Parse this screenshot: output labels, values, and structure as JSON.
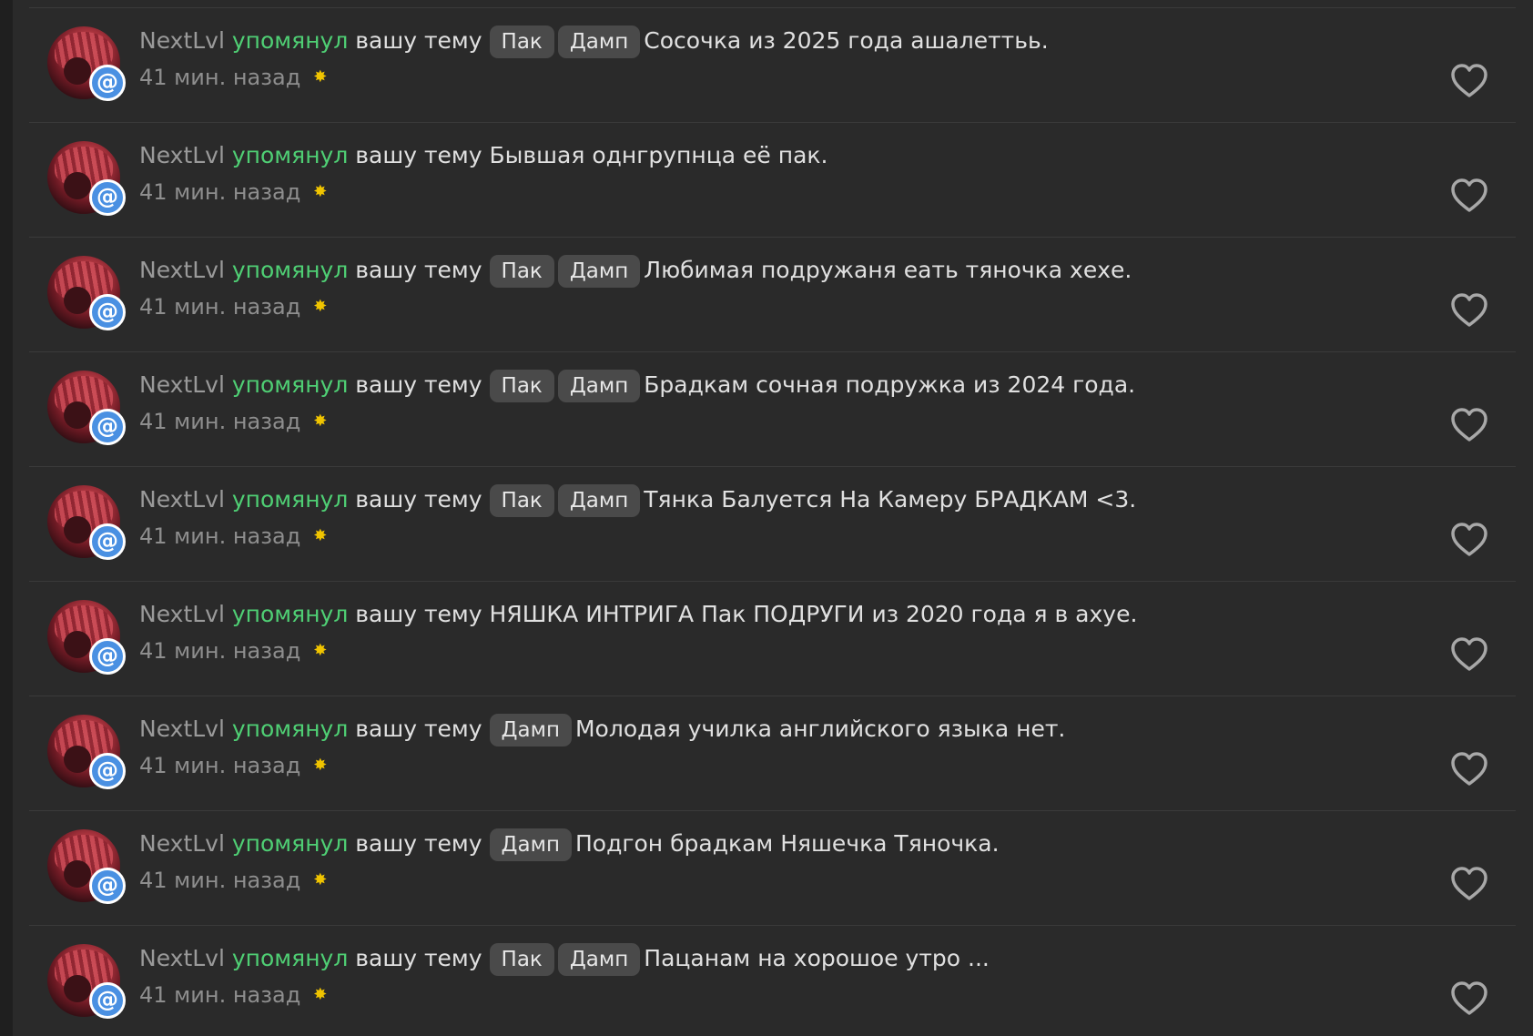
{
  "notifications": [
    {
      "user": "NextLvl",
      "action": "упомянул",
      "suffix": "вашу тему",
      "tags": [
        "Пак",
        "Дамп"
      ],
      "title": "Сосочка из 2025 года ашалеттьь.",
      "time": "41 мин. назад"
    },
    {
      "user": "NextLvl",
      "action": "упомянул",
      "suffix": "вашу тему",
      "tags": [],
      "title": "Бывшая однгрупнца её пак.",
      "time": "41 мин. назад"
    },
    {
      "user": "NextLvl",
      "action": "упомянул",
      "suffix": "вашу тему",
      "tags": [
        "Пак",
        "Дамп"
      ],
      "title": "Любимая подружаня еать тяночка хехе.",
      "time": "41 мин. назад"
    },
    {
      "user": "NextLvl",
      "action": "упомянул",
      "suffix": "вашу тему",
      "tags": [
        "Пак",
        "Дамп"
      ],
      "title": "Брадкам сочная подружка из 2024 года.",
      "time": "41 мин. назад"
    },
    {
      "user": "NextLvl",
      "action": "упомянул",
      "suffix": "вашу тему",
      "tags": [
        "Пак",
        "Дамп"
      ],
      "title": "Тянка Балуется На Камеру БРАДКАМ <3.",
      "time": "41 мин. назад"
    },
    {
      "user": "NextLvl",
      "action": "упомянул",
      "suffix": "вашу тему",
      "tags": [],
      "title": "НЯШКА ИНТРИГА Пак ПОДРУГИ из 2020 года я в ахуе.",
      "time": "41 мин. назад"
    },
    {
      "user": "NextLvl",
      "action": "упомянул",
      "suffix": "вашу тему",
      "tags": [
        "Дамп"
      ],
      "title": "Молодая училка английского языка нет.",
      "time": "41 мин. назад"
    },
    {
      "user": "NextLvl",
      "action": "упомянул",
      "suffix": "вашу тему",
      "tags": [
        "Дамп"
      ],
      "title": "Подгон брадкам Няшечка Тяночка.",
      "time": "41 мин. назад"
    },
    {
      "user": "NextLvl",
      "action": "упомянул",
      "suffix": "вашу тему",
      "tags": [
        "Пак",
        "Дамп"
      ],
      "title": "Пацанам на хорошое утро ...",
      "time": "41 мин. назад"
    }
  ],
  "badge_symbol": "@",
  "unread_marker": "✸",
  "colors": {
    "background": "#2a2a2a",
    "username": "#9a9a9a",
    "action": "#4fcf74",
    "tag_bg": "#4a4a4a",
    "badge": "#4a90e2",
    "unread": "#f0c400"
  }
}
